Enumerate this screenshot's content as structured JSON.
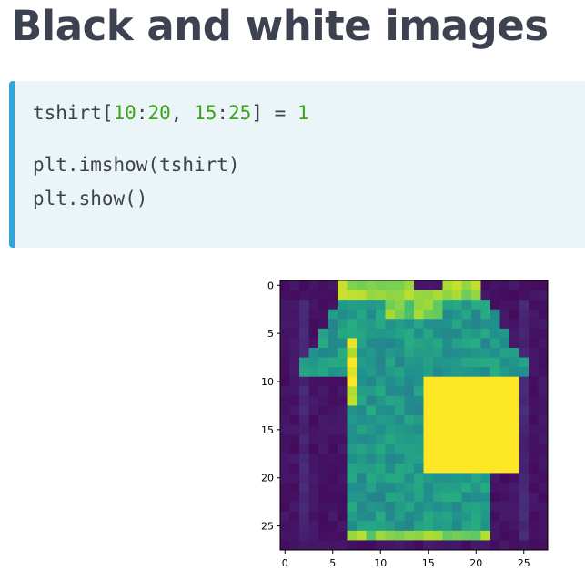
{
  "slide": {
    "title": "Black and white images"
  },
  "code": {
    "line1": {
      "var": "tshirt",
      "open": "[",
      "a1": "10",
      "c1": ":",
      "a2": "20",
      "sep": ", ",
      "b1": "15",
      "c2": ":",
      "b2": "25",
      "close": "] = ",
      "val": "1"
    },
    "line2": "plt.imshow(tshirt)",
    "line3": "plt.show()"
  },
  "chart_data": {
    "type": "heatmap",
    "colormap": "viridis",
    "grid_size": [
      28,
      28
    ],
    "xticks": [
      0,
      5,
      10,
      15,
      20,
      25
    ],
    "yticks": [
      0,
      5,
      10,
      15,
      20,
      25
    ],
    "xlim": [
      -0.5,
      27.5
    ],
    "ylim": [
      27.5,
      -0.5
    ],
    "highlight": {
      "rows": [
        10,
        20
      ],
      "cols": [
        15,
        25
      ],
      "value": 1
    },
    "shape": "t-shirt"
  },
  "colors": {
    "title": "#3d4251",
    "code_bg": "#ebf4f7",
    "code_accent": "#33a4d8",
    "code_number": "#3ba51a"
  }
}
